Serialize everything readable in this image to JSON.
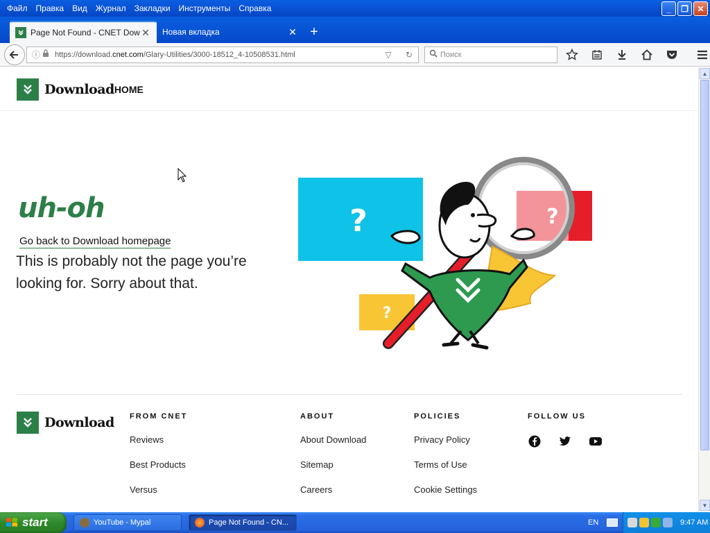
{
  "window": {
    "menu": [
      "Файл",
      "Правка",
      "Вид",
      "Журнал",
      "Закладки",
      "Инструменты",
      "Справка"
    ],
    "controls": {
      "minimize": "_",
      "maximize": "❐",
      "close": "✕"
    }
  },
  "tabs": [
    {
      "label": "Page Not Found - CNET Down...",
      "active": true,
      "close": "✕"
    },
    {
      "label": "Новая вкладка",
      "active": false,
      "close": "✕"
    }
  ],
  "newtab_label": "+",
  "navbar": {
    "url_prefix": "https://download.",
    "url_domain": "cnet.com",
    "url_path": "/Glary-Utilities/3000-18512_4-10508531.html",
    "search_placeholder": "Поиск"
  },
  "site": {
    "brand": "Download",
    "home_link": "HOME",
    "error_title": "uh-oh",
    "back_link": "Go back to Download homepage",
    "message": "This is probably not the page you’re looking for. Sorry about that.",
    "colors": {
      "brand_green": "#2d7f48",
      "box_blue": "#0fc2e8",
      "box_red": "#e61e2a",
      "box_yellow": "#f8c535"
    },
    "illustration_marks": [
      "?",
      "?",
      "?"
    ]
  },
  "footer": {
    "brand": "Download",
    "columns": [
      {
        "heading": "FROM CNET",
        "links": [
          "Reviews",
          "Best Products",
          "Versus"
        ]
      },
      {
        "heading": "ABOUT",
        "links": [
          "About Download",
          "Sitemap",
          "Careers"
        ]
      },
      {
        "heading": "POLICIES",
        "links": [
          "Privacy Policy",
          "Terms of Use",
          "Cookie Settings"
        ]
      },
      {
        "heading": "FOLLOW US",
        "social": [
          "facebook-icon",
          "twitter-icon",
          "youtube-icon"
        ]
      }
    ]
  },
  "taskbar": {
    "start_label": "start",
    "tasks": [
      {
        "label": "YouTube - Mypal",
        "active": false
      },
      {
        "label": "Page Not Found - CN...",
        "active": true
      }
    ],
    "language": "EN",
    "clock": "9:47 AM"
  }
}
